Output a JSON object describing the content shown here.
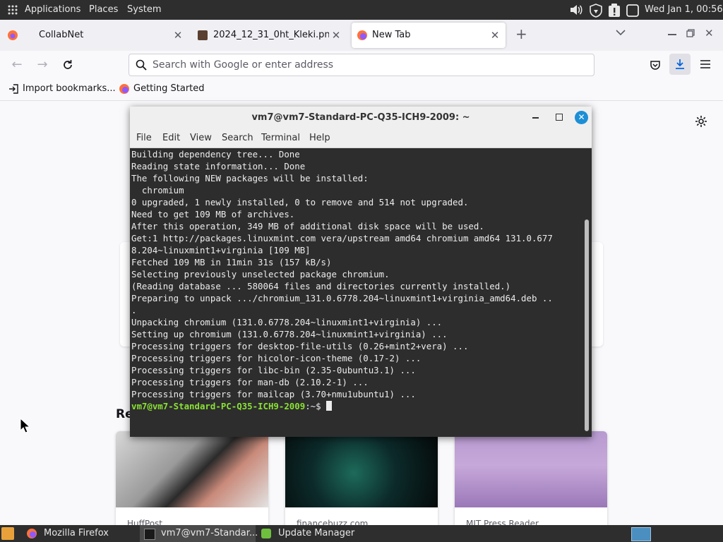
{
  "top_panel": {
    "applications": "Applications",
    "places": "Places",
    "system": "System",
    "clock": "Wed Jan  1, 00:56"
  },
  "browser": {
    "tabs": [
      {
        "title": "CollabNet",
        "active": false
      },
      {
        "title": "2024_12_31_0ht_Kleki.png",
        "active": false
      },
      {
        "title": "New Tab",
        "active": true
      }
    ],
    "new_tab_button": "+",
    "url_placeholder": "Search with Google or enter address",
    "bookmarks": [
      {
        "label": "Import bookmarks..."
      },
      {
        "label": "Getting Started"
      }
    ],
    "newtab": {
      "section_heading_partial": "Re",
      "cards": [
        {
          "source": "HuffPost"
        },
        {
          "source": "financebuzz.com"
        },
        {
          "source": "MIT Press Reader"
        }
      ]
    }
  },
  "terminal": {
    "title": "vm7@vm7-Standard-PC-Q35-ICH9-2009: ~",
    "menu": [
      "File",
      "Edit",
      "View",
      "Search",
      "Terminal",
      "Help"
    ],
    "output": "Building dependency tree... Done\nReading state information... Done\nThe following NEW packages will be installed:\n  chromium\n0 upgraded, 1 newly installed, 0 to remove and 514 not upgraded.\nNeed to get 109 MB of archives.\nAfter this operation, 349 MB of additional disk space will be used.\nGet:1 http://packages.linuxmint.com vera/upstream amd64 chromium amd64 131.0.677\n8.204~linuxmint1+virginia [109 MB]\nFetched 109 MB in 11min 31s (157 kB/s)\nSelecting previously unselected package chromium.\n(Reading database ... 580064 files and directories currently installed.)\nPreparing to unpack .../chromium_131.0.6778.204~linuxmint1+virginia_amd64.deb ..\n.\nUnpacking chromium (131.0.6778.204~linuxmint1+virginia) ...\nSetting up chromium (131.0.6778.204~linuxmint1+virginia) ...\nProcessing triggers for desktop-file-utils (0.26+mint2+vera) ...\nProcessing triggers for hicolor-icon-theme (0.17-2) ...\nProcessing triggers for libc-bin (2.35-0ubuntu3.1) ...\nProcessing triggers for man-db (2.10.2-1) ...\nProcessing triggers for mailcap (3.70+nmu1ubuntu1) ...",
    "prompt_user": "vm7@vm7-Standard-PC-Q35-ICH9-2009",
    "prompt_suffix": ":~$ "
  },
  "taskbar": {
    "items": [
      {
        "label": "Mozilla Firefox"
      },
      {
        "label": "vm7@vm7-Standar..."
      },
      {
        "label": "Update Manager"
      }
    ]
  },
  "colors": {
    "prompt_green": "#8ae234",
    "terminal_bg": "#2d2d2d",
    "panel_bg": "#2e2e2e",
    "close_button": "#1c8fd6"
  }
}
